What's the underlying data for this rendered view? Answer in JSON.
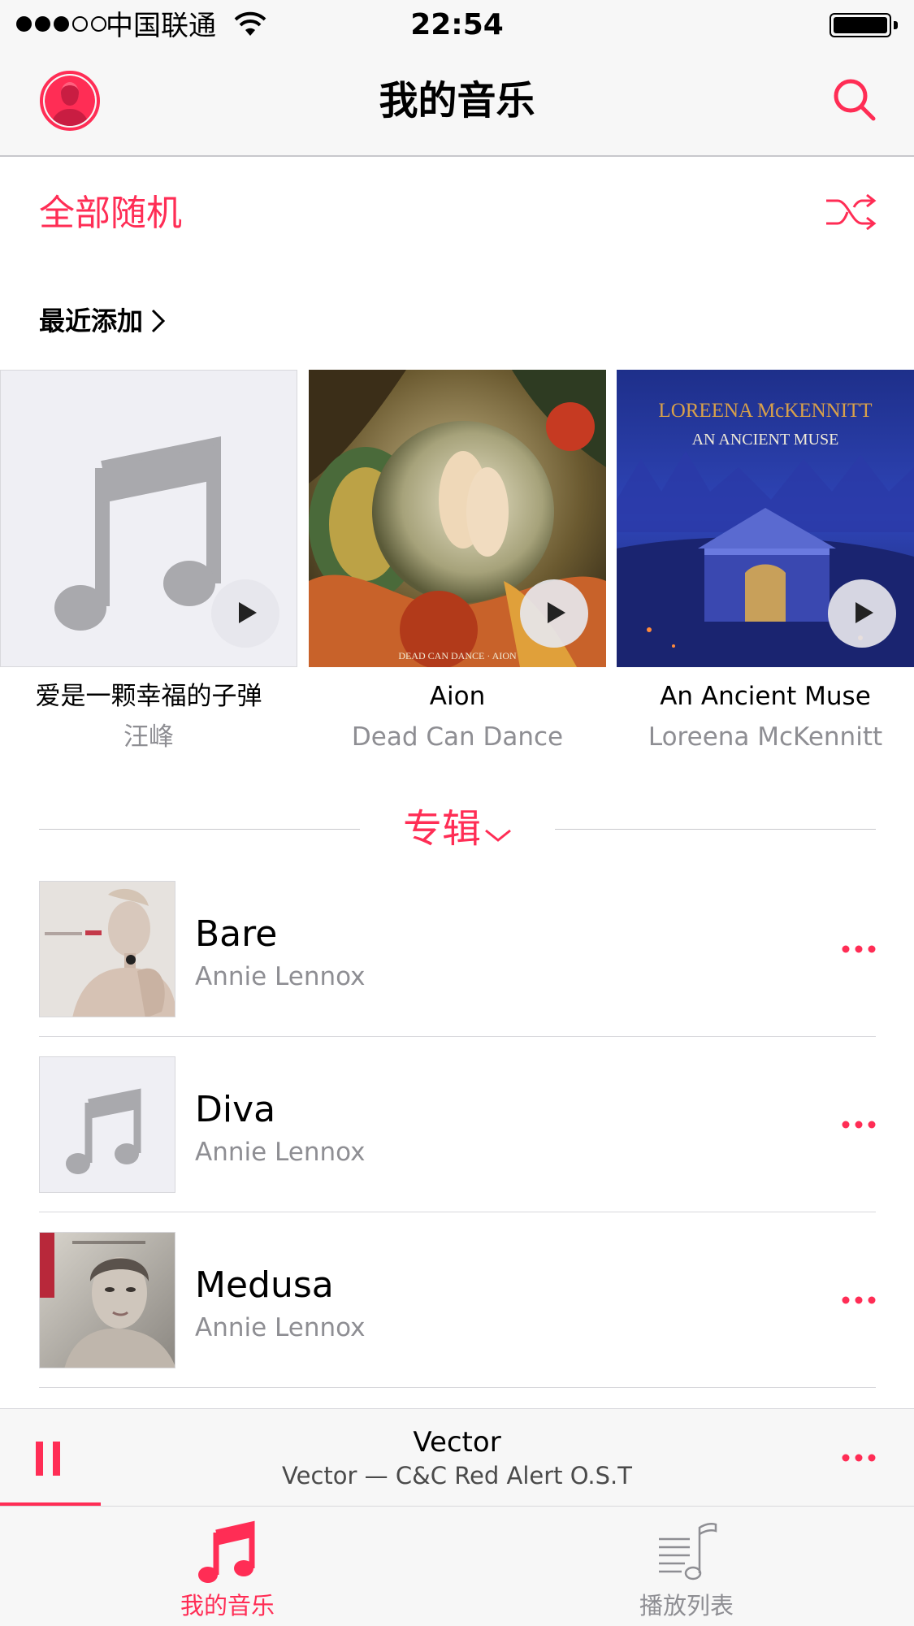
{
  "status_bar": {
    "carrier": "中国联通",
    "time": "22:54"
  },
  "nav": {
    "title": "我的音乐"
  },
  "shuffle": {
    "label": "全部随机"
  },
  "recently_added": {
    "label": "最近添加",
    "items": [
      {
        "title": "爱是一颗幸福的子弹",
        "artist": "汪峰",
        "cover": "placeholder-music-icon"
      },
      {
        "title": "Aion",
        "artist": "Dead Can Dance",
        "cover": "aion-artwork",
        "cover_text": "DEAD CAN DANCE · AION"
      },
      {
        "title": "An Ancient Muse",
        "artist": "Loreena McKennitt",
        "cover": "ancient-muse-artwork",
        "cover_text_1": "LOREENA McKENNITT",
        "cover_text_2": "AN ANCIENT MUSE"
      }
    ]
  },
  "section": {
    "label": "专辑"
  },
  "albums": [
    {
      "name": "Bare",
      "artist": "Annie Lennox",
      "thumb": "bare-artwork"
    },
    {
      "name": "Diva",
      "artist": "Annie Lennox",
      "thumb": "placeholder-music-icon"
    },
    {
      "name": "Medusa",
      "artist": "Annie Lennox",
      "thumb": "medusa-artwork"
    }
  ],
  "now_playing": {
    "title": "Vector",
    "subtitle": "Vector — C&C Red Alert O.S.T",
    "progress": 0.11
  },
  "tabs": [
    {
      "label": "我的音乐",
      "active": true
    },
    {
      "label": "播放列表",
      "active": false
    }
  ],
  "colors": {
    "accent": "#ff2d55",
    "secondary_text": "#8e8e93"
  }
}
